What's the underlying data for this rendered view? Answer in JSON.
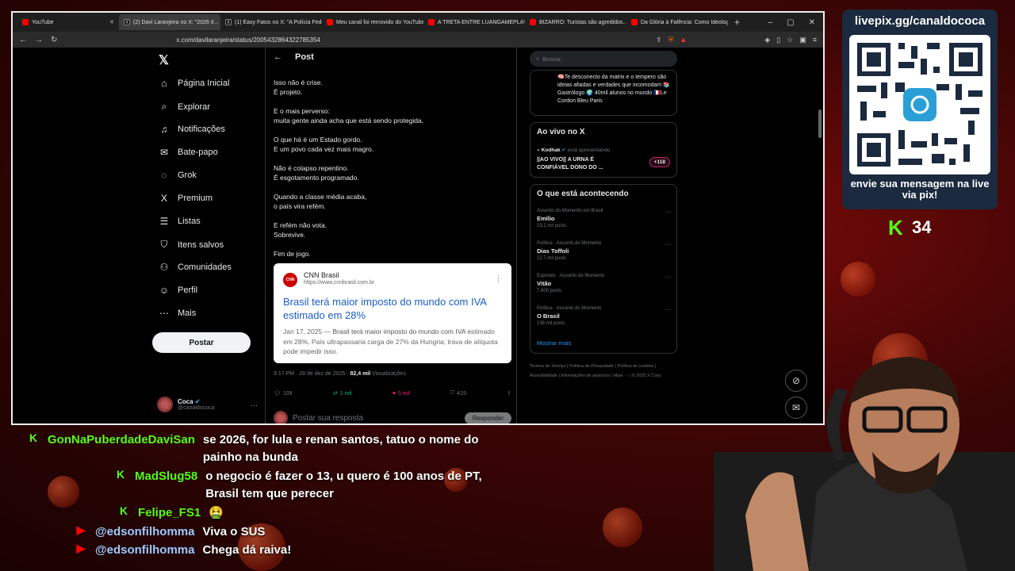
{
  "browser": {
    "tabs": [
      {
        "title": "YouTube",
        "icon": "yt"
      },
      {
        "title": "(2) Davi Laranjeira no X: \"2026 é...",
        "icon": "x",
        "active": true
      },
      {
        "title": "(1) Easy Fatos no X: \"A Polícia Federal...",
        "icon": "x"
      },
      {
        "title": "Meu canal foi removido do YouTube...",
        "icon": "yt"
      },
      {
        "title": "A TRETA ENTRE LUANGAMEPLAY E...",
        "icon": "yt"
      },
      {
        "title": "BIZARRO: Turistas são agredidos...",
        "icon": "yt"
      },
      {
        "title": "Da Glória à Falência: Como Ideologia...",
        "icon": "yt"
      }
    ],
    "url": "x.com/davilaranjeira/status/2005432864322785354"
  },
  "x": {
    "nav": [
      {
        "label": "Página Inicial",
        "icon": "home-icon",
        "glyph": "⌂"
      },
      {
        "label": "Explorar",
        "icon": "search-icon",
        "glyph": "⌕"
      },
      {
        "label": "Notificações",
        "icon": "bell-icon",
        "glyph": "♫"
      },
      {
        "label": "Bate-papo",
        "icon": "mail-icon",
        "glyph": "✉"
      },
      {
        "label": "Grok",
        "icon": "grok-icon",
        "glyph": "◌"
      },
      {
        "label": "Premium",
        "icon": "x-premium-icon",
        "glyph": "X"
      },
      {
        "label": "Listas",
        "icon": "list-icon",
        "glyph": "☰"
      },
      {
        "label": "Itens salvos",
        "icon": "bookmark-icon",
        "glyph": "⛉"
      },
      {
        "label": "Comunidades",
        "icon": "people-icon",
        "glyph": "⚇"
      },
      {
        "label": "Perfil",
        "icon": "person-icon",
        "glyph": "☺"
      },
      {
        "label": "Mais",
        "icon": "more-icon",
        "glyph": "⋯"
      }
    ],
    "post_button": "Postar",
    "profile": {
      "name": "Coca",
      "handle": "@canaldococa"
    },
    "post": {
      "header": "Post",
      "paragraphs": [
        "Isso não é crise.\nÉ projeto.",
        "E o mais perverso:\nmuita gente ainda acha que está sendo protegida.",
        "O que há é um Estado gordo.\nE um povo cada vez mais magro.",
        "Não é colapso repentino.\nÉ esgotamento programado.",
        "Quando a classe média acaba,\no país vira refém.",
        "E refém não vota.\nSobrevive.",
        "Fim de jogo."
      ],
      "card": {
        "source": "CNN Brasil",
        "logo": "CNN",
        "url": "https://www.cnnbrasil.com.br",
        "headline": "Brasil terá maior imposto do mundo com IVA estimado em 28%",
        "date": "Jan 17, 2025 —",
        "excerpt_bold": "Brasil terá maior imposto do mundo com IVA",
        "excerpt_rest": "estimado em 28%. País ultrapassaria carga de 27% da Hungria; trava de alíquota pode impedir isso."
      },
      "meta_time": "9:17 PM · 28 de dez de 2025 · ",
      "meta_views": "82,4 mil",
      "meta_views_label": " Visualizações",
      "replies": "109",
      "reposts": "1 mil",
      "likes": "5 mil",
      "bookmarks": "419",
      "reply_placeholder": "Postar sua resposta",
      "reply_button": "Responder"
    },
    "right": {
      "search_placeholder": "Buscar",
      "bio": "🧠Te desconecto da matrix e o tempero são ideias afiadas e verdades que incomodam 📚Gastrólogo 🌍 40mil alunos no mundo 🇫🇷Le Cordon Bleu Paris",
      "live": {
        "title": "Ao vivo no X",
        "host": "Kodhak",
        "host_suffix": " está apresentando",
        "stream_title": "||AO VIVO|| A URNA É CONFIÁVEL DONO DO ...",
        "badge": "+118"
      },
      "trends_title": "O que está acontecendo",
      "trends": [
        {
          "category": "Assunto do Momento em Brasil",
          "name": "Emílio",
          "count": "13,2 mil posts"
        },
        {
          "category": "Política · Assunto do Momento",
          "name": "Dias Toffoli",
          "count": "12,7 mil posts"
        },
        {
          "category": "Esportes · Assunto do Momento",
          "name": "Vitão",
          "count": "7.600 posts"
        },
        {
          "category": "Política · Assunto do Momento",
          "name": "O Brasil",
          "count": "136 mil posts"
        }
      ],
      "show_more": "Mostrar mais",
      "footer": "Termos de Serviço  |  Política de Privacidade  |  Política de cookies  |  Acessibilidade  |  Informações de anúncios  |  Mais ···  |  © 2025 X Corp."
    }
  },
  "overlay": {
    "qr_title": "livepix.gg/canaldococa",
    "qr_caption": "envie sua mensagem na live via pix!",
    "kick_count": "34"
  },
  "chat": [
    {
      "platform": "kick",
      "user": "GonNaPuberdadeDaviSan",
      "message": "se 2026, for lula e renan santos, tatuo o nome do painho na bunda"
    },
    {
      "platform": "kick",
      "user": "MadSlug58",
      "message": "o negocio é fazer o 13, u quero é 100 anos de PT, Brasil tem que perecer"
    },
    {
      "platform": "kick",
      "user": "Felipe_FS1",
      "message": "🤮"
    },
    {
      "platform": "youtube",
      "user": "@edsonfilhomma",
      "message": "Viva o SUS"
    },
    {
      "platform": "youtube",
      "user": "@edsonfilhomma",
      "message": "Chega dá raiva!"
    }
  ]
}
